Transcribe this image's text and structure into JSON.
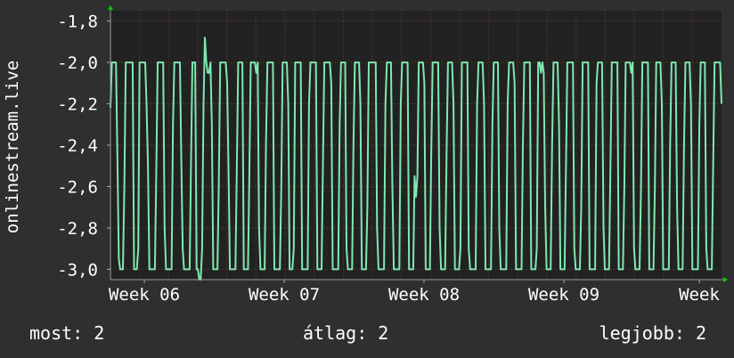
{
  "chart_data": {
    "type": "line",
    "ylabel": "onlinestream.live",
    "ylim": [
      -3.05,
      -1.75
    ],
    "y_ticks": [
      {
        "value": -1.8,
        "label": "-1,8"
      },
      {
        "value": -2.0,
        "label": "-2,0"
      },
      {
        "value": -2.2,
        "label": "-2,2"
      },
      {
        "value": -2.4,
        "label": "-2,4"
      },
      {
        "value": -2.6,
        "label": "-2,6"
      },
      {
        "value": -2.8,
        "label": "-2,8"
      },
      {
        "value": -3.0,
        "label": "-3,0"
      }
    ],
    "x_ticks": [
      "Week 06",
      "Week 07",
      "Week 08",
      "Week 09",
      "Week"
    ],
    "grid": true,
    "series": [
      {
        "color": "#7fe8b0",
        "values": [
          -2.22,
          -2.0,
          -2.0,
          -2.0,
          -2.0,
          -2.46,
          -2.95,
          -3.0,
          -3.0,
          -3.0,
          -2.6,
          -2.0,
          -2.0,
          -2.0,
          -2.0,
          -2.0,
          -2.0,
          -3.0,
          -3.0,
          -3.0,
          -2.9,
          -2.0,
          -2.0,
          -2.0,
          -2.0,
          -2.0,
          -2.2,
          -2.5,
          -3.0,
          -3.0,
          -3.0,
          -3.0,
          -3.0,
          -2.55,
          -2.0,
          -2.0,
          -2.0,
          -2.0,
          -2.0,
          -2.8,
          -3.0,
          -3.0,
          -3.0,
          -3.0,
          -3.0,
          -2.3,
          -2.0,
          -2.0,
          -2.0,
          -2.0,
          -2.0,
          -2.46,
          -2.9,
          -3.0,
          -3.0,
          -3.0,
          -3.0,
          -3.0,
          -2.5,
          -2.0,
          -2.0,
          -2.0,
          -3.0,
          -3.0,
          -3.05,
          -3.05,
          -2.9,
          -2.2,
          -1.88,
          -2.0,
          -2.05,
          -2.05,
          -2.0,
          -2.3,
          -3.0,
          -3.0,
          -3.0,
          -3.0,
          -2.6,
          -2.0,
          -2.0,
          -2.0,
          -2.0,
          -2.0,
          -2.1,
          -2.5,
          -3.0,
          -3.0,
          -3.0,
          -3.0,
          -3.0,
          -2.5,
          -2.0,
          -2.0,
          -2.0,
          -2.0,
          -3.0,
          -3.0,
          -3.0,
          -3.0,
          -2.55,
          -2.0,
          -2.0,
          -2.0,
          -2.0,
          -2.05,
          -2.0,
          -2.8,
          -3.0,
          -3.0,
          -3.0,
          -3.0,
          -2.4,
          -2.0,
          -2.0,
          -2.0,
          -2.0,
          -2.0,
          -3.0,
          -3.0,
          -3.0,
          -3.0,
          -3.0,
          -2.6,
          -2.0,
          -2.0,
          -2.0,
          -2.0,
          -2.2,
          -3.0,
          -3.0,
          -3.0,
          -2.9,
          -2.0,
          -2.0,
          -2.0,
          -2.0,
          -2.0,
          -3.0,
          -3.0,
          -3.0,
          -3.0,
          -3.0,
          -2.2,
          -2.0,
          -2.0,
          -2.0,
          -2.0,
          -2.0,
          -3.0,
          -3.0,
          -3.0,
          -3.0,
          -2.5,
          -2.0,
          -2.0,
          -2.0,
          -2.0,
          -2.0,
          -2.1,
          -3.0,
          -3.0,
          -3.0,
          -3.0,
          -3.0,
          -2.3,
          -2.0,
          -2.0,
          -2.0,
          -2.0,
          -2.9,
          -3.0,
          -3.0,
          -3.0,
          -3.0,
          -2.4,
          -2.0,
          -2.0,
          -2.0,
          -2.0,
          -2.2,
          -3.0,
          -3.0,
          -3.0,
          -3.0,
          -2.7,
          -2.0,
          -2.0,
          -2.0,
          -2.0,
          -2.0,
          -2.0,
          -2.8,
          -3.0,
          -3.0,
          -3.0,
          -3.0,
          -3.0,
          -2.2,
          -2.0,
          -2.0,
          -2.0,
          -2.0,
          -2.6,
          -3.0,
          -3.0,
          -3.0,
          -3.0,
          -3.0,
          -2.2,
          -2.0,
          -2.0,
          -2.0,
          -2.0,
          -2.0,
          -3.0,
          -3.0,
          -3.0,
          -3.0,
          -2.55,
          -2.65,
          -2.55,
          -2.0,
          -2.0,
          -2.0,
          -2.0,
          -2.1,
          -3.0,
          -3.0,
          -3.0,
          -3.0,
          -2.45,
          -2.0,
          -2.0,
          -2.0,
          -2.0,
          -2.0,
          -2.8,
          -3.0,
          -3.0,
          -3.0,
          -3.0,
          -2.45,
          -2.0,
          -2.0,
          -2.0,
          -2.0,
          -2.2,
          -3.0,
          -3.0,
          -3.0,
          -3.0,
          -2.9,
          -2.0,
          -2.0,
          -2.0,
          -2.0,
          -2.0,
          -2.9,
          -3.0,
          -3.0,
          -3.0,
          -3.0,
          -3.0,
          -2.2,
          -2.0,
          -2.0,
          -2.0,
          -2.0,
          -2.2,
          -3.0,
          -3.0,
          -3.0,
          -3.0,
          -3.0,
          -2.3,
          -2.0,
          -2.0,
          -2.0,
          -2.0,
          -2.8,
          -3.0,
          -3.0,
          -3.0,
          -3.0,
          -3.0,
          -2.2,
          -2.0,
          -2.0,
          -2.0,
          -2.0,
          -2.1,
          -3.0,
          -3.0,
          -3.0,
          -3.0,
          -3.0,
          -2.4,
          -2.0,
          -2.0,
          -2.0,
          -2.0,
          -2.0,
          -3.0,
          -3.0,
          -3.0,
          -3.0,
          -2.9,
          -2.0,
          -2.0,
          -2.05,
          -2.0,
          -2.05,
          -2.7,
          -3.0,
          -3.0,
          -3.0,
          -3.0,
          -2.4,
          -2.0,
          -2.0,
          -2.0,
          -2.0,
          -2.3,
          -3.0,
          -3.0,
          -3.0,
          -3.0,
          -2.5,
          -2.0,
          -2.0,
          -2.0,
          -2.0,
          -2.0,
          -2.9,
          -3.0,
          -3.0,
          -3.0,
          -3.0,
          -2.7,
          -2.0,
          -2.0,
          -2.0,
          -2.0,
          -2.0,
          -3.0,
          -3.0,
          -3.0,
          -3.0,
          -3.0,
          -2.1,
          -2.0,
          -2.0,
          -2.0,
          -2.0,
          -2.8,
          -3.0,
          -3.0,
          -3.0,
          -3.0,
          -2.5,
          -2.0,
          -2.0,
          -2.0,
          -2.0,
          -2.0,
          -3.0,
          -3.0,
          -3.0,
          -3.0,
          -2.6,
          -2.0,
          -2.0,
          -2.0,
          -2.0,
          -2.05,
          -2.0,
          -2.9,
          -3.0,
          -3.0,
          -3.0,
          -3.0,
          -2.6,
          -2.0,
          -2.0,
          -2.0,
          -2.0,
          -2.0,
          -3.0,
          -3.0,
          -3.0,
          -3.0,
          -2.6,
          -2.0,
          -2.0,
          -2.0,
          -2.0,
          -2.2,
          -3.0,
          -3.0,
          -3.0,
          -3.0,
          -3.0,
          -2.4,
          -2.0,
          -2.0,
          -2.0,
          -2.0,
          -2.7,
          -3.0,
          -3.0,
          -3.0,
          -3.0,
          -2.4,
          -2.0,
          -2.0,
          -2.0,
          -2.0,
          -2.2,
          -3.0,
          -3.0,
          -3.0,
          -3.0,
          -3.0,
          -2.3,
          -2.0,
          -2.0,
          -2.0,
          -2.0,
          -2.9,
          -3.0,
          -3.0,
          -3.0,
          -3.0,
          -2.5,
          -2.0,
          -2.0,
          -2.0,
          -2.0,
          -2.0,
          -2.2
        ]
      }
    ]
  },
  "stats": {
    "current": "most: 2",
    "average": "átlag: 2",
    "maximum": "legjobb: 2"
  },
  "colors": {
    "background": "#2f2f2f",
    "plot_background": "#222222",
    "grid": "#6a3a3a",
    "line": "#7fe8b0",
    "axis_arrow": "#00cc00"
  }
}
